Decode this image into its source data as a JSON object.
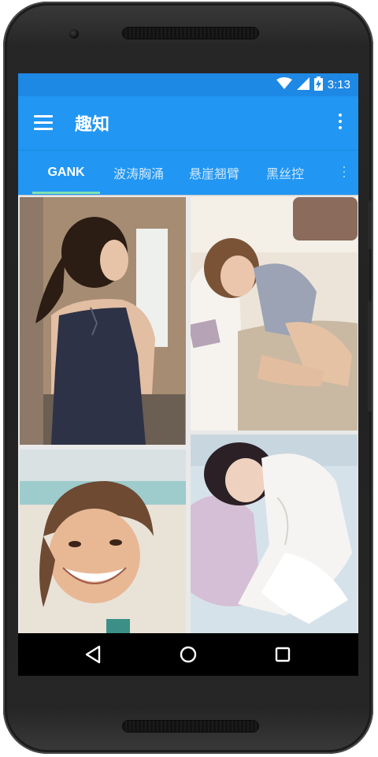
{
  "status_bar": {
    "time": "3:13",
    "icons": [
      "wifi-icon",
      "signal-icon",
      "battery-charging-icon"
    ]
  },
  "app_bar": {
    "title": "趣知",
    "menu_icon": "hamburger-menu-icon",
    "overflow_icon": "more-vert-icon"
  },
  "tabs": [
    {
      "label": "GANK",
      "active": true
    },
    {
      "label": "波涛胸涌",
      "active": false
    },
    {
      "label": "悬崖翘臂",
      "active": false
    },
    {
      "label": "黑丝控",
      "active": false
    }
  ],
  "tabs_more_icon": "more-tabs-icon",
  "grid": {
    "photos": [
      {
        "name": "photo-girl-ponytail"
      },
      {
        "name": "photo-girl-sofa"
      },
      {
        "name": "photo-girl-smiling"
      },
      {
        "name": "photo-girl-white-dress"
      }
    ]
  },
  "nav_bar": {
    "buttons": [
      "back-icon",
      "home-icon",
      "recents-icon"
    ]
  },
  "colors": {
    "status_bar": "#1e88e5",
    "primary": "#2196f3",
    "tab_indicator": "#80e0b0",
    "nav_bar": "#000000"
  }
}
